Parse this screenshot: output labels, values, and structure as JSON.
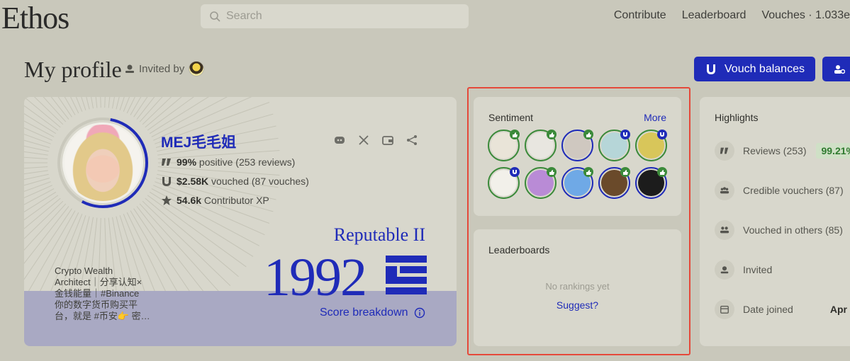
{
  "header": {
    "brand": "Ethos",
    "search_placeholder": "Search",
    "nav": [
      "Contribute",
      "Leaderboard",
      "Vouches · 1.033e"
    ]
  },
  "title_row": {
    "title": "My profile",
    "invited_by": "Invited by",
    "vouch_balances": "Vouch balances"
  },
  "profile": {
    "name": "MEJ毛毛姐",
    "stats": [
      {
        "bold": "99%",
        "rest": " positive (253 reviews)"
      },
      {
        "bold": "$2.58K",
        "rest": " vouched (87 vouches)"
      },
      {
        "bold": "54.6k",
        "rest": " Contributor XP"
      }
    ],
    "bio": [
      "Crypto Wealth",
      "Architect｜分享认知×",
      "金钱能量｜#Binance",
      "你的数字货币购买平",
      "台，就是 #币安👉 密…"
    ],
    "tier": "Reputable II",
    "score": "1992",
    "score_breakdown": "Score breakdown"
  },
  "sentiment": {
    "title": "Sentiment",
    "more": "More",
    "voters": [
      {
        "ring": "green",
        "badge": "green",
        "color": "#e9e4d8"
      },
      {
        "ring": "green",
        "badge": "green",
        "color": "#e8e6e0"
      },
      {
        "ring": "blue",
        "badge": "green",
        "color": "#cfc8c0"
      },
      {
        "ring": "green",
        "badge": "blue",
        "color": "#b6d6d8"
      },
      {
        "ring": "green",
        "badge": "blue",
        "color": "#d8c65a"
      },
      {
        "ring": "green",
        "badge": "blue",
        "color": "#f2f0ea"
      },
      {
        "ring": "green",
        "badge": "green",
        "color": "#b98bd6"
      },
      {
        "ring": "blue",
        "badge": "green",
        "color": "#6fa9e6"
      },
      {
        "ring": "blue",
        "badge": "green",
        "color": "#6a4a2a"
      },
      {
        "ring": "blue",
        "badge": "green",
        "color": "#1c1c1c"
      }
    ]
  },
  "leaderboards": {
    "title": "Leaderboards",
    "empty": "No rankings yet",
    "suggest": "Suggest?"
  },
  "highlights": {
    "title": "Highlights",
    "rows": [
      {
        "label": "Reviews (253)",
        "extra": "99.21%"
      },
      {
        "label": "Credible vouchers (87)"
      },
      {
        "label": "Vouched in others (85)"
      },
      {
        "label": "Invited"
      },
      {
        "label": "Date joined",
        "value": "Apr"
      }
    ]
  }
}
